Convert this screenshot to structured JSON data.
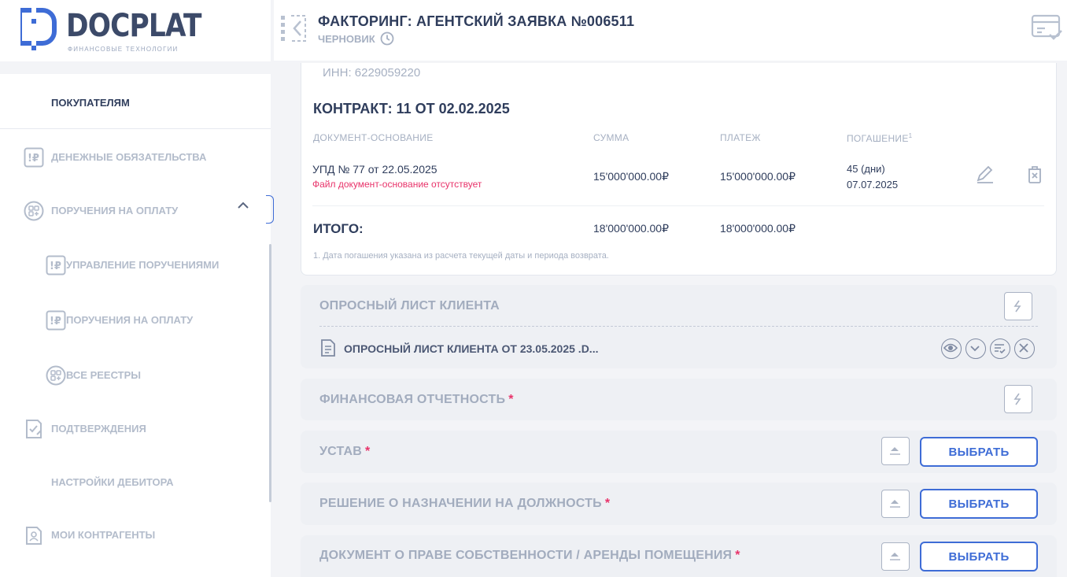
{
  "brand": {
    "name": "DOCPLAT",
    "tagline": "ФИНАНСОВЫЕ ТЕХНОЛОГИИ",
    "accent": "#3e6cd6"
  },
  "sidebar": {
    "items": [
      {
        "label": "ПОКУПАТЕЛЯМ",
        "icon": "none"
      },
      {
        "label": "ДЕНЕЖНЫЕ ОБЯЗАТЕЛЬСТВА",
        "icon": "ruble-doc-icon"
      },
      {
        "label": "ПОРУЧЕНИЯ НА ОПЛАТУ",
        "icon": "grid-plus-icon",
        "expanded": true
      },
      {
        "label": "УПРАВЛЕНИЕ ПОРУЧЕНИЯМИ",
        "icon": "ruble-doc-icon"
      },
      {
        "label": "ПОРУЧЕНИЯ НА ОПЛАТУ",
        "icon": "ruble-doc-icon"
      },
      {
        "label": "ВСЕ РЕЕСТРЫ",
        "icon": "grid-plus-icon"
      },
      {
        "label": "ПОДТВЕРЖДЕНИЯ",
        "icon": "check-doc-icon"
      },
      {
        "label": "НАСТРОЙКИ ДЕБИТОРА",
        "icon": "none"
      },
      {
        "label": "МОИ КОНТРАГЕНТЫ",
        "icon": "contact-doc-icon"
      }
    ]
  },
  "header": {
    "title": "ФАКТОРИНГ: АГЕНТСКИЙ ЗАЯВКА №006511",
    "status": "ЧЕРНОВИК"
  },
  "contract": {
    "inn": "ИНН: 6229059220",
    "title": "КОНТРАКТ: 11 ОТ 02.02.2025",
    "columns": {
      "doc": "ДОКУМЕНТ-ОСНОВАНИЕ",
      "sum": "СУММА",
      "payment": "ПЛАТЕЖ",
      "repayment": "ПОГАШЕНИЕ",
      "repayment_sup": "1"
    },
    "row": {
      "doc": "УПД № 77 от 22.05.2025",
      "error": "Файл документ-основание отсутствует",
      "sum": "15'000'000.00₽",
      "payment": "15'000'000.00₽",
      "days": "45 (дни)",
      "date": "07.07.2025"
    },
    "total": {
      "label": "ИТОГО:",
      "sum": "18'000'000.00₽",
      "payment": "18'000'000.00₽"
    },
    "note": "1. Дата погашения указана из расчета текущей даты и периода возврата."
  },
  "sections": {
    "questionnaire": {
      "title": "ОПРОСНЫЙ ЛИСТ КЛИЕНТА",
      "file": "ОПРОСНЫЙ ЛИСТ КЛИЕНТА ОТ 23.05.2025 .D..."
    },
    "financial": {
      "title": "ФИНАНСОВАЯ ОТЧЕТНОСТЬ",
      "required": "*"
    },
    "charter": {
      "title": "УСТАВ",
      "required": "*",
      "button": "ВЫБРАТЬ"
    },
    "appointment": {
      "title": "РЕШЕНИЕ О НАЗНАЧЕНИИ НА ДОЛЖНОСТЬ",
      "required": "*",
      "button": "ВЫБРАТЬ"
    },
    "property": {
      "title": "ДОКУМЕНТ О ПРАВЕ СОБСТВЕННОСТИ / АРЕНДЫ ПОМЕЩЕНИЯ",
      "required": "*",
      "button": "ВЫБРАТЬ"
    }
  }
}
